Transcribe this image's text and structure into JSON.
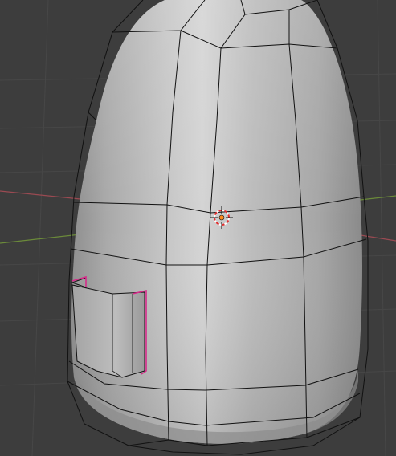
{
  "viewport": {
    "background": "#3d3d3d",
    "grid_line_color": "#474747",
    "x_axis_color": "#9a4a52",
    "y_axis_color": "#6b8a3a"
  },
  "mesh": {
    "surface_color": "#b8b8b8",
    "wire_color": "#101010",
    "selected_edge_color": "#d62b8a",
    "shading": "solid"
  },
  "origin_marker": {
    "icon": "3d-cursor-icon",
    "dot_color": "#ff8a1e",
    "ring_colors": [
      "#ffffff",
      "#e03030"
    ]
  }
}
